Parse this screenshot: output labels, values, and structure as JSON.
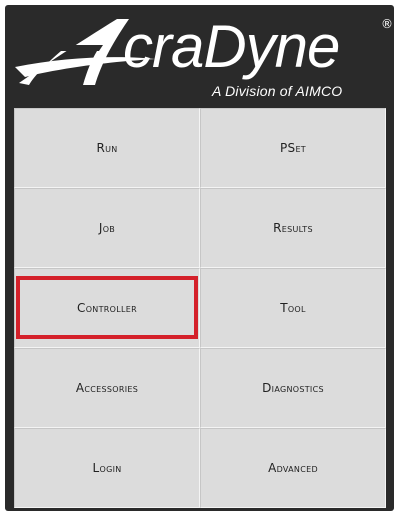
{
  "header": {
    "brand": "craDyne",
    "brand_initial": "A",
    "registered_mark": "®",
    "tagline": "A Division of AIMCO"
  },
  "menu": {
    "items": [
      {
        "label": "Run"
      },
      {
        "label": "PSet"
      },
      {
        "label": "Job"
      },
      {
        "label": "Results"
      },
      {
        "label": "Controller"
      },
      {
        "label": "Tool"
      },
      {
        "label": "Accessories"
      },
      {
        "label": "Diagnostics"
      },
      {
        "label": "Login"
      },
      {
        "label": "Advanced"
      }
    ],
    "highlighted_item": "Controller"
  },
  "colors": {
    "background": "#2a2a2a",
    "tile": "#dcdcdc",
    "highlight": "#d4202a",
    "logo": "#ffffff"
  }
}
